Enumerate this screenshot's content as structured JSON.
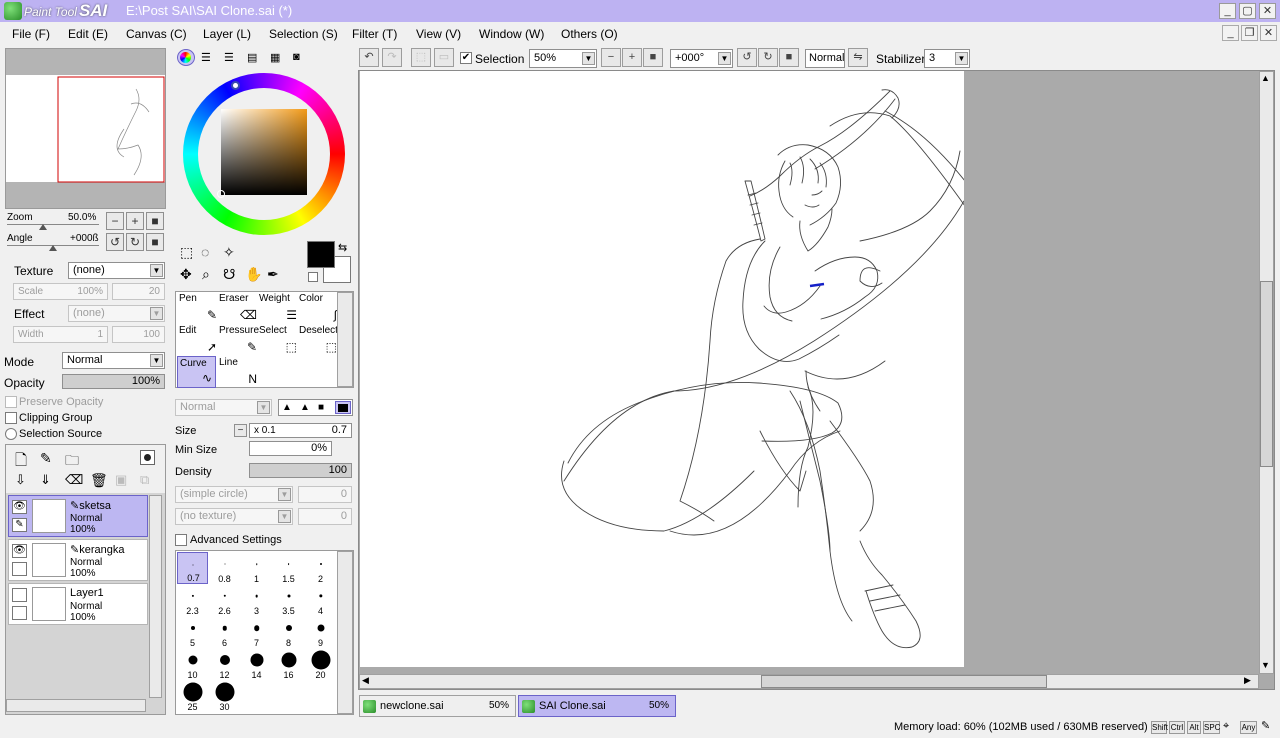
{
  "window": {
    "app_name_1": "Paint Tool",
    "app_name_2": "SAI",
    "title": "E:\\Post SAI\\SAI Clone.sai (*)"
  },
  "menu": [
    "File (F)",
    "Edit (E)",
    "Canvas (C)",
    "Layer (L)",
    "Selection (S)",
    "Filter (T)",
    "View (V)",
    "Window (W)",
    "Others (O)"
  ],
  "navigator": {
    "zoom_label": "Zoom",
    "zoom_value": "50.0%",
    "angle_label": "Angle",
    "angle_value": "+000ß"
  },
  "layer_props": {
    "texture_label": "Texture",
    "texture_value": "(none)",
    "scale_label": "Scale",
    "scale_value": "100%",
    "scale_num": "20",
    "effect_label": "Effect",
    "effect_value": "(none)",
    "width_label": "Width",
    "width_value": "1",
    "width_num": "100",
    "mode_label": "Mode",
    "mode_value": "Normal",
    "opacity_label": "Opacity",
    "opacity_value": "100%",
    "preserve_opacity": "Preserve Opacity",
    "clipping_group": "Clipping Group",
    "selection_source": "Selection Source"
  },
  "layers": [
    {
      "name": "sketsa",
      "mode": "Normal",
      "opacity": "100%",
      "selected": true
    },
    {
      "name": "kerangka",
      "mode": "Normal",
      "opacity": "100%",
      "selected": false
    },
    {
      "name": "Layer1",
      "mode": "Normal",
      "opacity": "100%",
      "selected": false
    }
  ],
  "tools": [
    {
      "label": "Pen",
      "icon": "pen-icon"
    },
    {
      "label": "Eraser",
      "icon": "eraser-icon"
    },
    {
      "label": "Weight",
      "icon": "weight-icon"
    },
    {
      "label": "Color",
      "icon": "color-tool-icon"
    },
    {
      "label": "Edit",
      "icon": "edit-cursor-icon"
    },
    {
      "label": "Pressure",
      "icon": "pressure-icon"
    },
    {
      "label": "Select",
      "icon": "select-tool-icon"
    },
    {
      "label": "Deselect",
      "icon": "deselect-tool-icon"
    },
    {
      "label": "Curve",
      "icon": "curve-icon"
    },
    {
      "label": "Line",
      "icon": "line-icon"
    }
  ],
  "brush": {
    "blend_mode": "Normal",
    "size_label": "Size",
    "size_multiplier": "x 0.1",
    "size_value": "0.7",
    "min_size_label": "Min Size",
    "min_size_value": "0%",
    "density_label": "Density",
    "density_value": "100",
    "shape": "(simple circle)",
    "shape_value": "0",
    "texture": "(no texture)",
    "texture_value": "0",
    "advanced_settings": "Advanced Settings",
    "selected_size": "0.7",
    "sizes": [
      "0.7",
      "0.8",
      "1",
      "1.5",
      "2",
      "2.3",
      "2.6",
      "3",
      "3.5",
      "4",
      "5",
      "6",
      "7",
      "8",
      "9",
      "10",
      "12",
      "14",
      "16",
      "20",
      "25",
      "30"
    ]
  },
  "colors": {
    "accent": "#bdb7f2",
    "title_bar": "#bdb2f2",
    "primary_color": "#000000",
    "secondary_color": "#ffffff"
  },
  "canvas_toolbar": {
    "selection_label": "Selection",
    "selection_checked": true,
    "zoom": "50%",
    "angle": "+000°",
    "blend": "Normal",
    "stabilizer_label": "Stabilizer",
    "stabilizer_value": "3"
  },
  "doc_tabs": [
    {
      "name": "newclone.sai",
      "zoom": "50%",
      "selected": false
    },
    {
      "name": "SAI Clone.sai",
      "zoom": "50%",
      "selected": true
    }
  ],
  "status": {
    "memory": "Memory load: 60% (102MB used / 630MB reserved)",
    "keys": [
      "Shift",
      "Ctrl",
      "Alt",
      "SPC",
      "Any"
    ]
  }
}
